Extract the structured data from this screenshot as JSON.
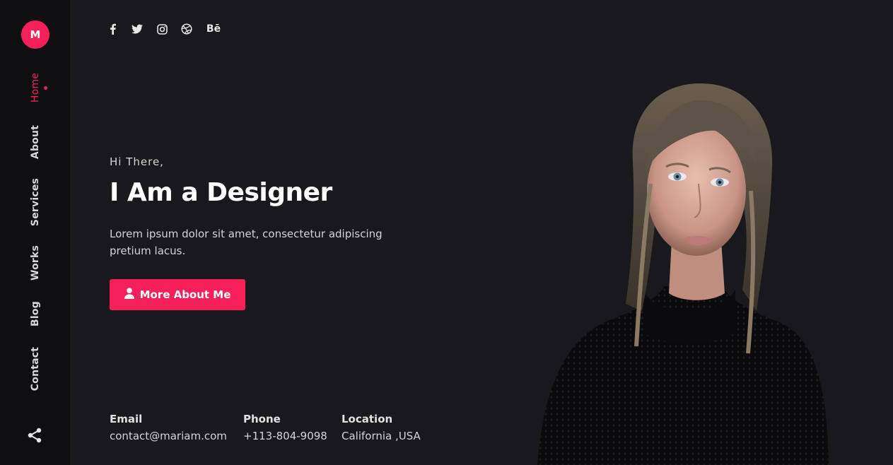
{
  "sidebar": {
    "logo_letter": "M",
    "nav": [
      {
        "label": "Home",
        "active": true
      },
      {
        "label": "About",
        "active": false
      },
      {
        "label": "Services",
        "active": false
      },
      {
        "label": "Works",
        "active": false
      },
      {
        "label": "Blog",
        "active": false
      },
      {
        "label": "Contact",
        "active": false
      }
    ],
    "share_icon": "share-icon"
  },
  "social": {
    "icons": [
      "facebook-icon",
      "twitter-icon",
      "instagram-icon",
      "dribbble-icon",
      "behance-icon"
    ],
    "behance_text": "Bē"
  },
  "hero": {
    "greeting": "Hi There,",
    "headline": "I Am a Designer",
    "intro": "Lorem ipsum dolor sit amet, consectetur adipiscing pretium lacus.",
    "cta_label": "More About Me",
    "cta_icon": "user-icon"
  },
  "contact": {
    "email_label": "Email",
    "email_value": "contact@mariam.com",
    "phone_label": "Phone",
    "phone_value": "+113-804-9098",
    "location_label": "Location",
    "location_value": "California ,USA"
  },
  "colors": {
    "accent": "#f5205a",
    "background": "#18181d",
    "sidebar": "#0f0f12"
  }
}
